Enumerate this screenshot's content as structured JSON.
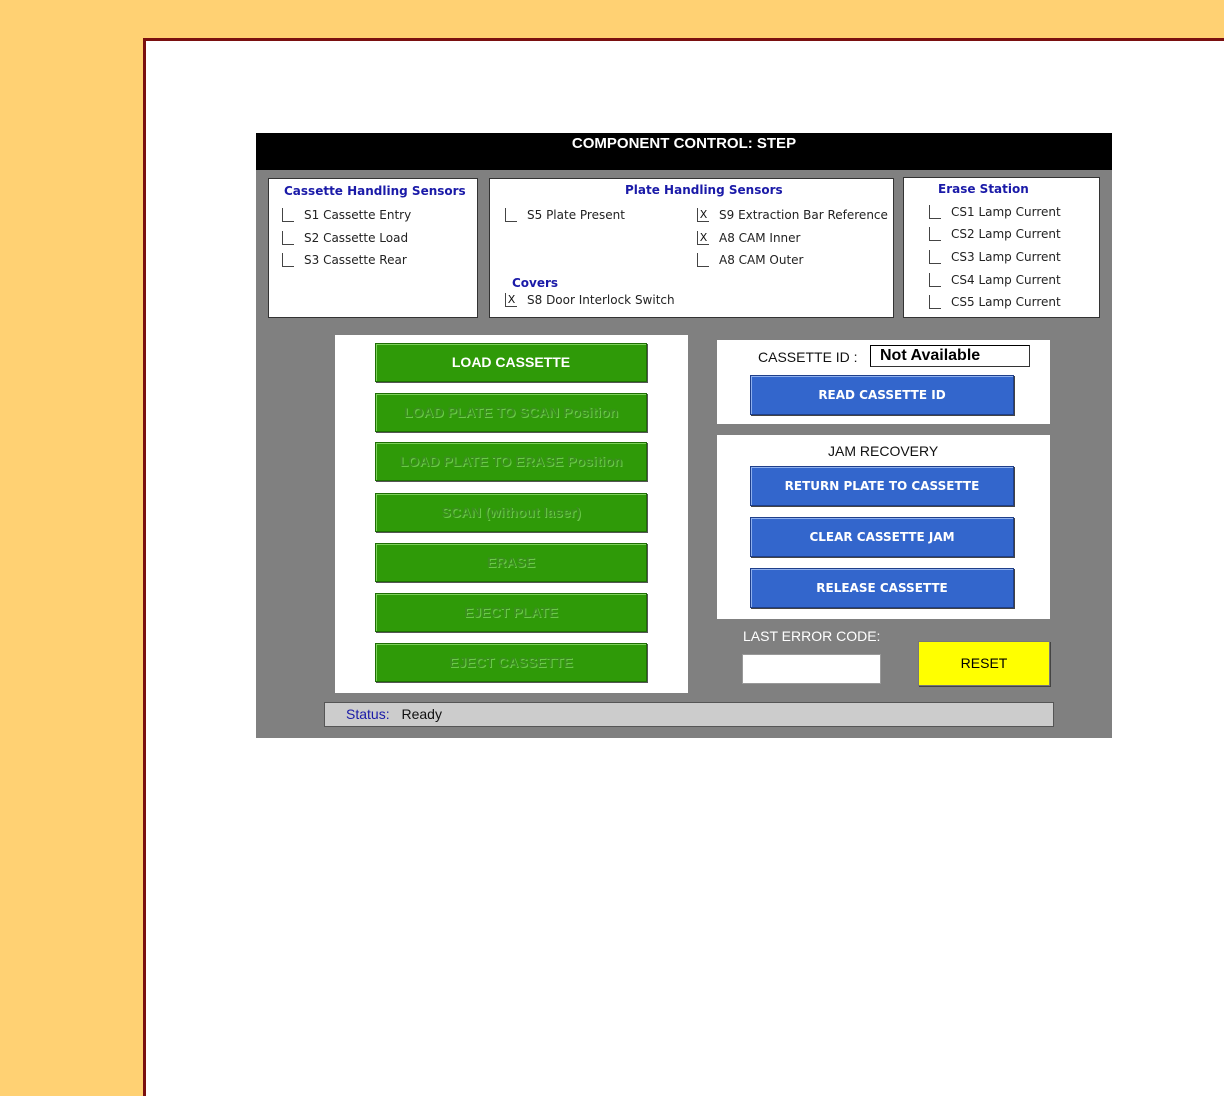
{
  "window": {
    "title": "COMPONENT CONTROL: STEP"
  },
  "cassette_sensors": {
    "title": "Cassette Handling Sensors",
    "items": [
      {
        "label": "S1 Cassette Entry",
        "checked": ""
      },
      {
        "label": "S2 Cassette Load",
        "checked": ""
      },
      {
        "label": "S3 Cassette Rear",
        "checked": ""
      }
    ]
  },
  "plate_sensors": {
    "title": "Plate Handling Sensors",
    "items": [
      {
        "label": "S5 Plate Present",
        "checked": ""
      },
      {
        "label": "S9 Extraction Bar Reference",
        "checked": "X"
      },
      {
        "label": "A8 CAM Inner",
        "checked": "X"
      },
      {
        "label": "A8 CAM Outer",
        "checked": ""
      }
    ],
    "covers_title": "Covers",
    "covers_items": [
      {
        "label": "S8 Door Interlock Switch",
        "checked": "X"
      }
    ]
  },
  "erase_station": {
    "title": "Erase Station",
    "items": [
      {
        "label": "CS1 Lamp Current",
        "checked": ""
      },
      {
        "label": "CS2 Lamp Current",
        "checked": ""
      },
      {
        "label": "CS3 Lamp Current",
        "checked": ""
      },
      {
        "label": "CS4 Lamp Current",
        "checked": ""
      },
      {
        "label": "CS5 Lamp Current",
        "checked": ""
      }
    ]
  },
  "actions": {
    "load_cassette": "LOAD CASSETTE",
    "load_plate_scan": "LOAD PLATE TO SCAN Position",
    "load_plate_erase": "LOAD PLATE TO ERASE Position",
    "scan": "SCAN (without laser)",
    "erase": "ERASE",
    "eject_plate": "EJECT PLATE",
    "eject_cassette": "EJECT CASSETTE"
  },
  "cassette_id": {
    "label": "CASSETTE ID :",
    "value": "Not Available",
    "read_button": "READ CASSETTE ID"
  },
  "jam_recovery": {
    "title": "JAM RECOVERY",
    "return_plate": "RETURN PLATE TO CASSETTE",
    "clear_jam": "CLEAR CASSETTE JAM",
    "release": "RELEASE CASSETTE"
  },
  "error": {
    "label": "LAST ERROR CODE:",
    "value": "",
    "reset_button": "RESET"
  },
  "status": {
    "label": "Status:",
    "value": "Ready"
  },
  "colors": {
    "green_button": "#2f9a08",
    "blue_button": "#3366cc",
    "reset_button": "#ffff00",
    "panel_title": "#1a1aa8"
  }
}
